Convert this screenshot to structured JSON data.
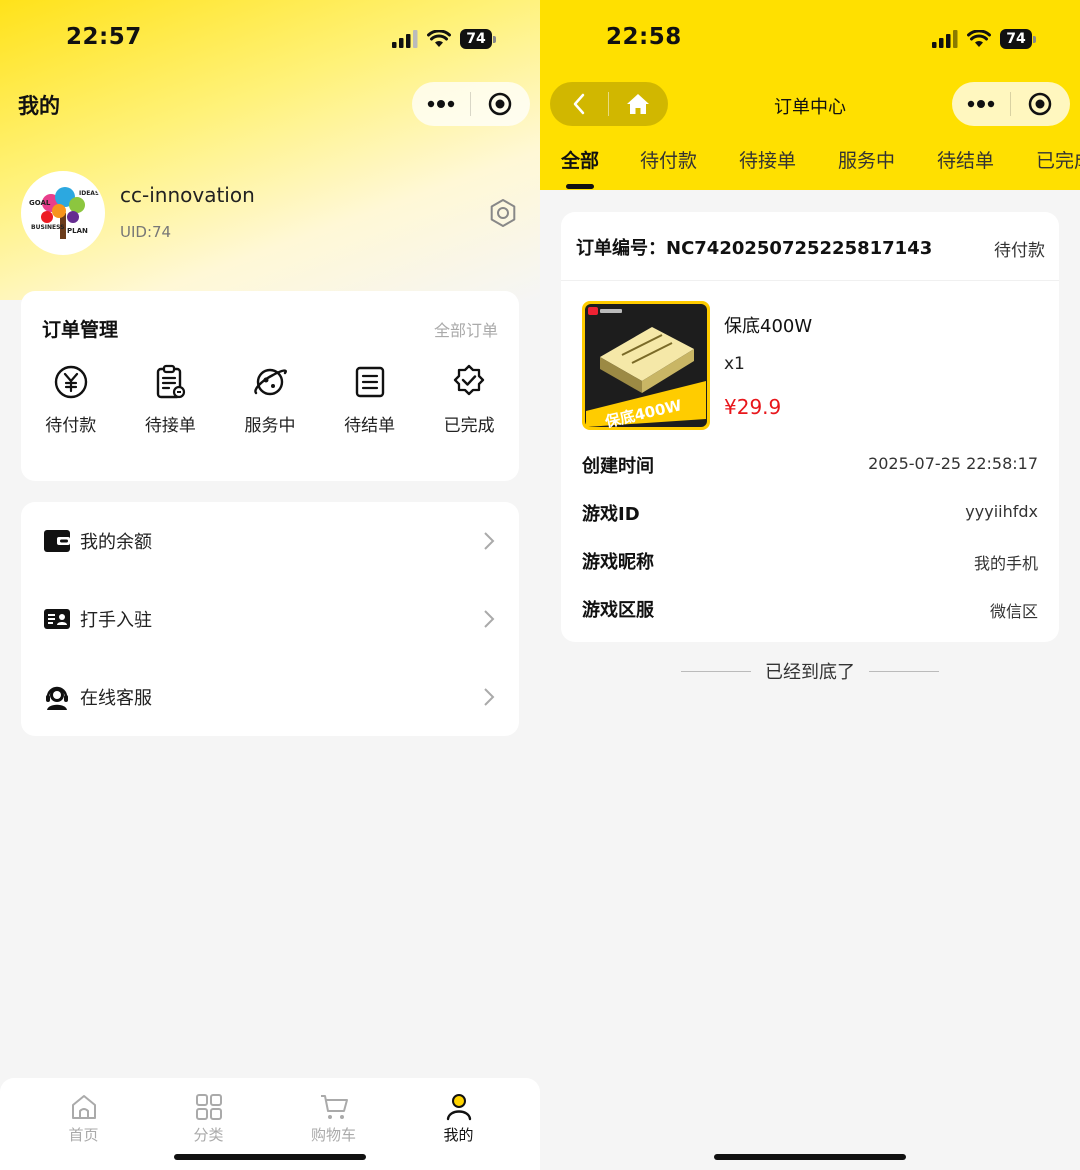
{
  "left": {
    "status": {
      "time": "22:57",
      "battery": "74"
    },
    "page_title": "我的",
    "profile": {
      "username": "cc-innovation",
      "uid": "UID:74"
    },
    "orders_card": {
      "title": "订单管理",
      "all_orders": "全部订单",
      "items": [
        {
          "label": "待付款",
          "icon": "yen-circle-icon"
        },
        {
          "label": "待接单",
          "icon": "clipboard-icon"
        },
        {
          "label": "服务中",
          "icon": "planet-icon"
        },
        {
          "label": "待结单",
          "icon": "document-list-icon"
        },
        {
          "label": "已完成",
          "icon": "badge-check-icon"
        }
      ]
    },
    "menu": [
      {
        "label": "我的余额",
        "icon": "wallet-icon"
      },
      {
        "label": "打手入驻",
        "icon": "id-card-icon"
      },
      {
        "label": "在线客服",
        "icon": "headset-icon"
      }
    ],
    "tabbar": [
      {
        "label": "首页",
        "icon": "home-icon"
      },
      {
        "label": "分类",
        "icon": "grid-icon"
      },
      {
        "label": "购物车",
        "icon": "cart-icon"
      },
      {
        "label": "我的",
        "icon": "user-icon"
      }
    ]
  },
  "right": {
    "status": {
      "time": "22:58",
      "battery": "74"
    },
    "nav_title": "订单中心",
    "tabs": [
      "全部",
      "待付款",
      "待接单",
      "服务中",
      "待结单",
      "已完成"
    ],
    "active_tab": "全部",
    "order": {
      "number_label": "订单编号：",
      "number": "NC7420250725225817143",
      "status": "待付款",
      "product": {
        "name": "保底400W",
        "quantity": "x1",
        "price": "¥29.9",
        "image_text": "保底400W"
      },
      "details": [
        {
          "label": "创建时间",
          "value": "2025-07-25 22:58:17"
        },
        {
          "label": "游戏ID",
          "value": "yyyiihfdx"
        },
        {
          "label": "游戏昵称",
          "value": "我的手机"
        },
        {
          "label": "游戏区服",
          "value": "微信区"
        }
      ]
    },
    "end_text": "已经到底了"
  },
  "colors": {
    "brand_yellow": "#ffe000",
    "price_red": "#e8161b"
  }
}
